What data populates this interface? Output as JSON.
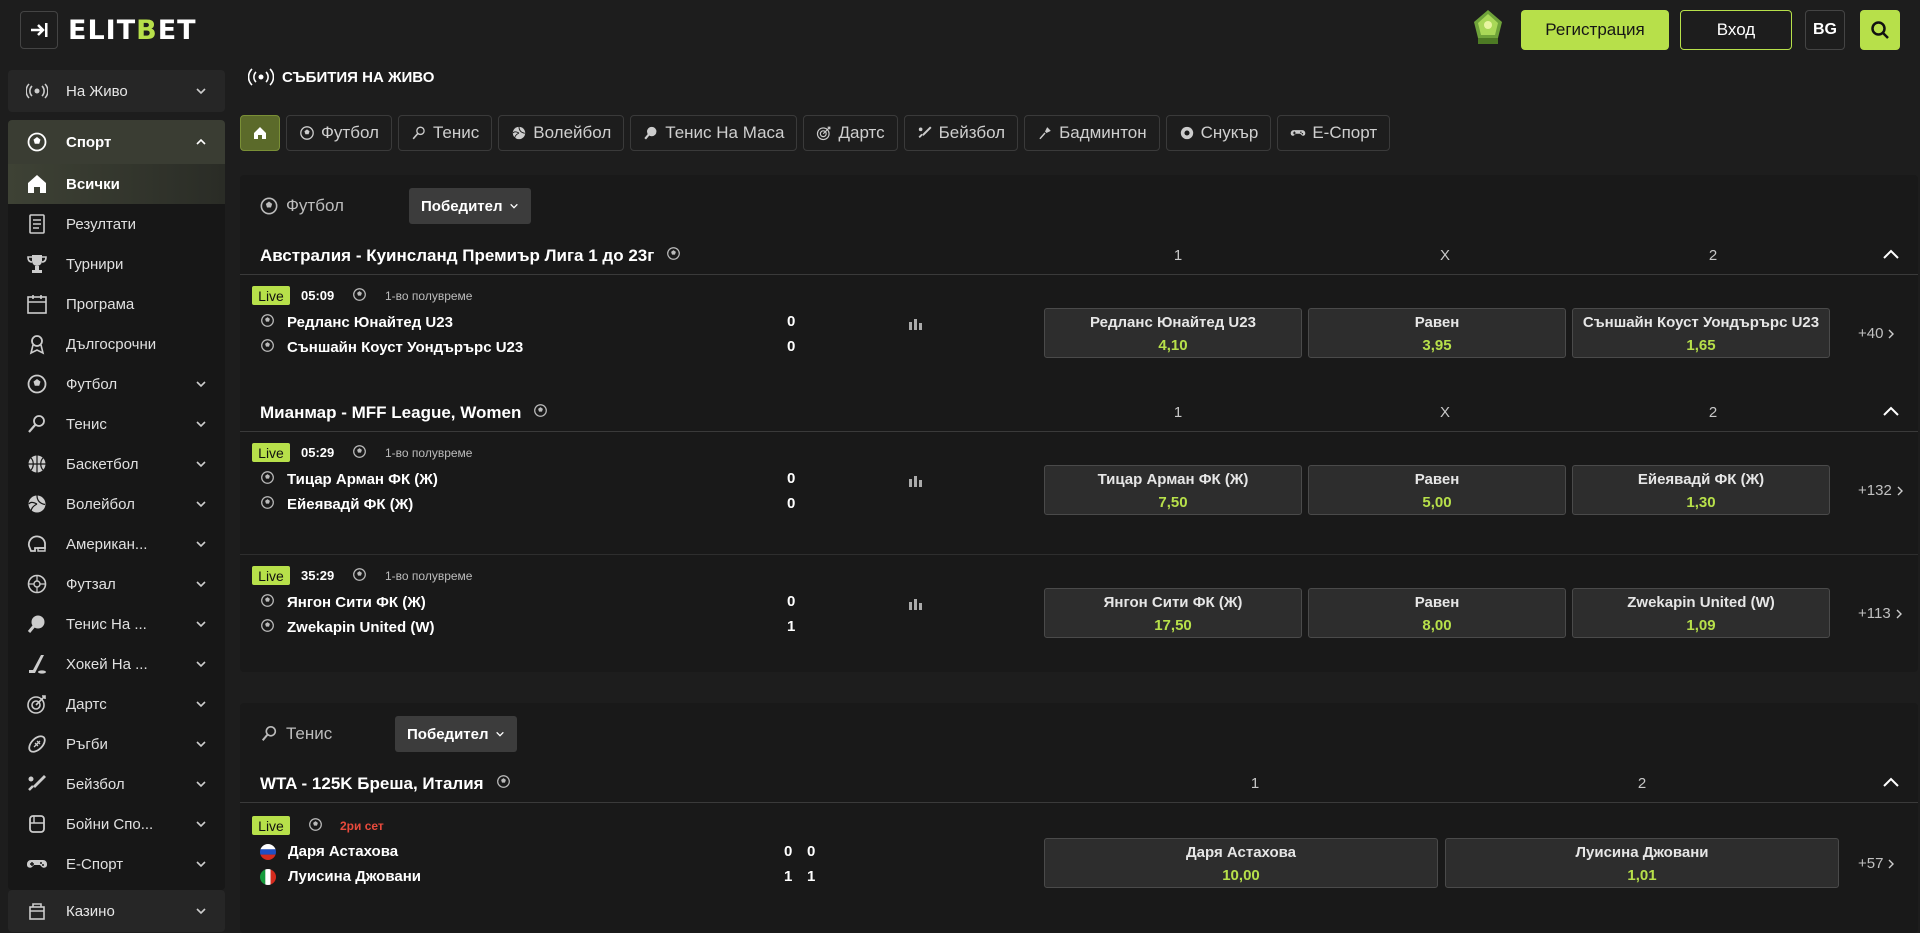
{
  "header": {
    "logo_text": "ELITBET",
    "register": "Регистрация",
    "login": "Вход",
    "lang": "BG"
  },
  "sidebar": {
    "live": "На Живо",
    "sport": "Спорт",
    "items": [
      {
        "label": "Всички",
        "icon": "home-icon"
      },
      {
        "label": "Резултати",
        "icon": "results-icon"
      },
      {
        "label": "Турнири",
        "icon": "trophy-icon"
      },
      {
        "label": "Програма",
        "icon": "calendar-icon"
      },
      {
        "label": "Дългосрочни",
        "icon": "award-icon"
      },
      {
        "label": "Футбол",
        "icon": "football-icon"
      },
      {
        "label": "Тенис",
        "icon": "tennis-icon"
      },
      {
        "label": "Баскетбол",
        "icon": "basketball-icon"
      },
      {
        "label": "Волейбол",
        "icon": "volleyball-icon"
      },
      {
        "label": "Американ...",
        "icon": "helmet-icon"
      },
      {
        "label": "Футзал",
        "icon": "futsal-icon"
      },
      {
        "label": "Тенис На ...",
        "icon": "table-tennis-icon"
      },
      {
        "label": "Хокей На ...",
        "icon": "hockey-icon"
      },
      {
        "label": "Дартс",
        "icon": "darts-icon"
      },
      {
        "label": "Ръгби",
        "icon": "rugby-icon"
      },
      {
        "label": "Бейзбол",
        "icon": "baseball-icon"
      },
      {
        "label": "Бойни Спо...",
        "icon": "fight-icon"
      },
      {
        "label": "Е-Спорт",
        "icon": "gamepad-icon"
      }
    ],
    "casino": "Казино"
  },
  "main": {
    "title": "Събития на живо",
    "tabs": [
      "Футбол",
      "Тенис",
      "Волейбол",
      "Тенис На Маса",
      "Дартс",
      "Бейзбол",
      "Бадминтон",
      "Снукър",
      "Е-Спорт"
    ]
  },
  "football": {
    "sport": "Футбол",
    "market": "Победител",
    "leagues": [
      {
        "name": "Австралия - Куинсланд Премиър Лига 1 до 23г",
        "h1": "1",
        "hx": "X",
        "h2": "2",
        "matches": [
          {
            "live": "Live",
            "time": "05:09",
            "period": "1-во полувреме",
            "home": "Редланс Юнайтед U23",
            "away": "Съншайн Коуст Уондърърс U23",
            "hs": "0",
            "as": "0",
            "o1n": "Редланс Юнайтед U23",
            "o1v": "4,10",
            "oxn": "Равен",
            "oxv": "3,95",
            "o2n": "Съншайн Коуст Уондърърс U23",
            "o2v": "1,65",
            "more": "+40"
          }
        ]
      },
      {
        "name": "Мианмар - MFF League, Women",
        "h1": "1",
        "hx": "X",
        "h2": "2",
        "matches": [
          {
            "live": "Live",
            "time": "05:29",
            "period": "1-во полувреме",
            "home": "Тицар Арман ФК (Ж)",
            "away": "Ейеявадй ФК (Ж)",
            "hs": "0",
            "as": "0",
            "o1n": "Тицар Арман ФК (Ж)",
            "o1v": "7,50",
            "oxn": "Равен",
            "oxv": "5,00",
            "o2n": "Ейеявадй ФК (Ж)",
            "o2v": "1,30",
            "more": "+132"
          },
          {
            "live": "Live",
            "time": "35:29",
            "period": "1-во полувреме",
            "home": "Янгон Сити ФК (Ж)",
            "away": "Zwekapin United (W)",
            "hs": "0",
            "as": "1",
            "o1n": "Янгон Сити ФК (Ж)",
            "o1v": "17,50",
            "oxn": "Равен",
            "oxv": "8,00",
            "o2n": "Zwekapin United (W)",
            "o2v": "1,09",
            "more": "+113"
          }
        ]
      }
    ]
  },
  "tennis": {
    "sport": "Тенис",
    "market": "Победител",
    "league": {
      "name": "WTA - 125K Бреша, Италия",
      "h1": "1",
      "h2": "2"
    },
    "match": {
      "live": "Live",
      "period": "2ри сет",
      "home": "Даря Астахова",
      "away": "Луисина Джовани",
      "hs1": "0",
      "hs2": "0",
      "as1": "1",
      "as2": "1",
      "o1n": "Даря Астахова",
      "o1v": "10,00",
      "o2n": "Луисина Джовани",
      "o2v": "1,01",
      "more": "+57"
    }
  }
}
